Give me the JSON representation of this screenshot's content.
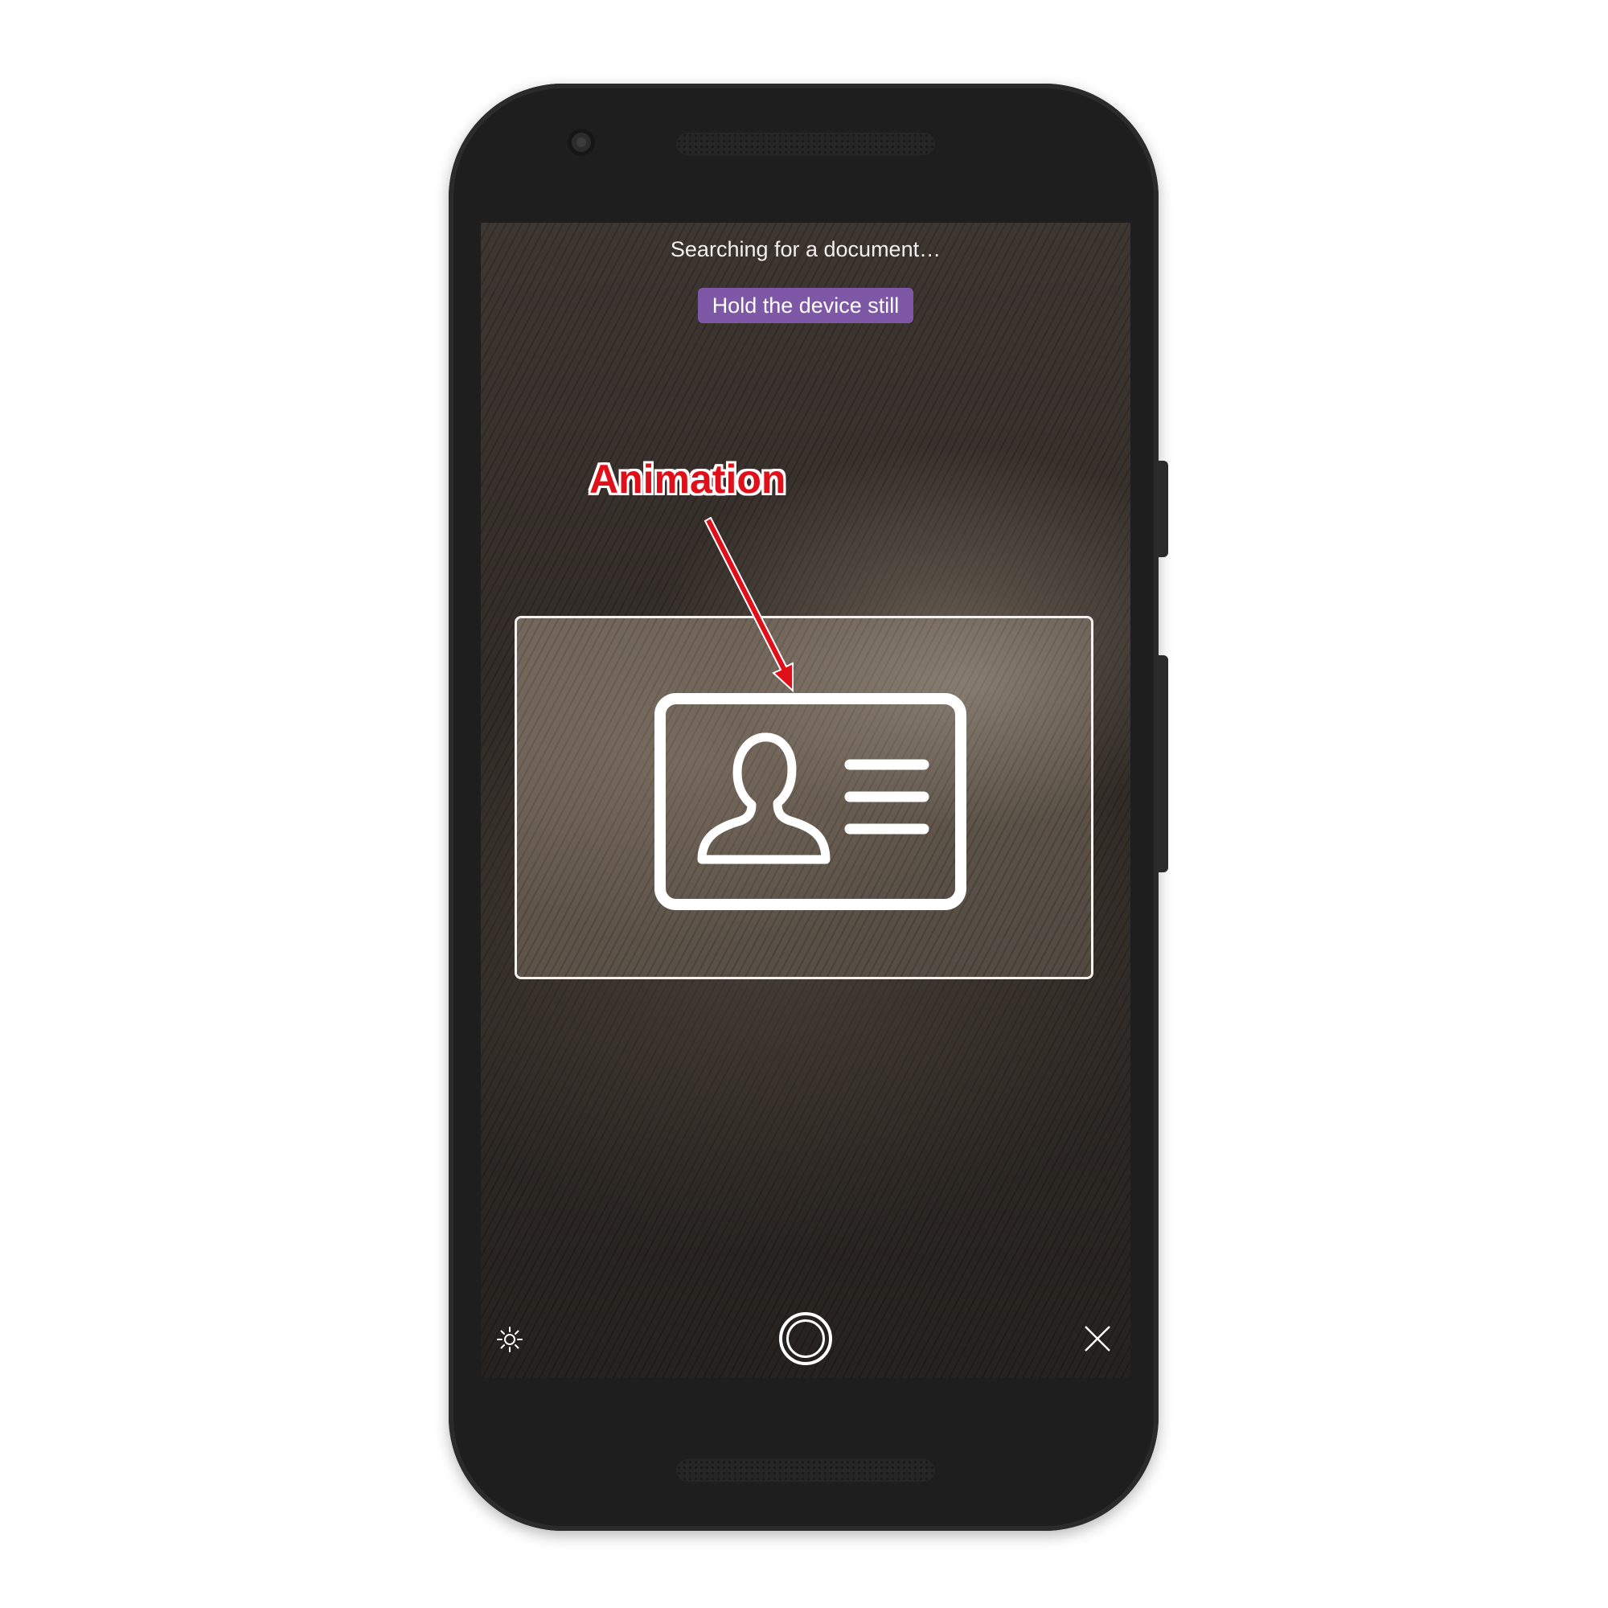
{
  "scanner": {
    "status_text": "Searching for a document…",
    "hint": "Hold the device still"
  },
  "annotation": {
    "label": "Animation",
    "color": "#e0101b"
  },
  "colors": {
    "hint_background": "#7e57a6",
    "phone_body": "#1e1e1f",
    "frame_border": "#f4f1ee"
  },
  "icons": {
    "document_placeholder": "id-card-icon",
    "flash": "flash-icon",
    "shutter": "shutter-icon",
    "close": "close-icon"
  }
}
